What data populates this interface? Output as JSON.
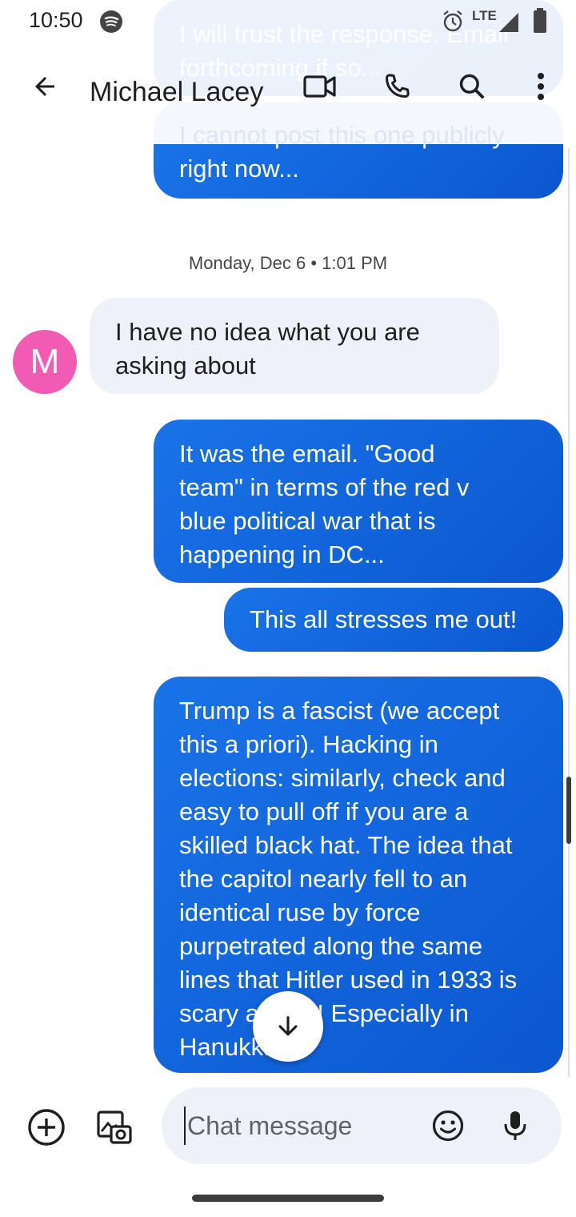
{
  "status": {
    "time": "10:50",
    "network": "LTE"
  },
  "header": {
    "contact_name": "Michael Lacey"
  },
  "conversation": {
    "top_messages": [
      {
        "text": "I will trust the response. Email forthcoming if so..."
      },
      {
        "text": "I cannot post this one publicly right now..."
      }
    ],
    "date_separator": "Monday, Dec 6 • 1:01 PM",
    "avatar_initial": "M",
    "incoming_1": "I have no idea what you are asking about",
    "outgoing_1": "It was the email. \"Good team\" in terms of the red v blue political war that is happening in DC...",
    "outgoing_2": "This all stresses me out!",
    "outgoing_3": "Trump is a fascist (we accept this a priori). Hacking in elections: similarly, check and easy to pull off if you are a skilled black hat. The idea that the capitol nearly fell to an identical ruse by force purpetrated along the same lines that Hitler used in 1933 is scary as hell! Especially in Hanukkah"
  },
  "composer": {
    "placeholder": "Chat message"
  },
  "colors": {
    "accent": "#1a73e8",
    "incoming_bubble": "#eef2f8",
    "avatar": "#f25bb4"
  },
  "icons": {
    "back": "arrow-back-icon",
    "video": "video-call-icon",
    "phone": "phone-icon",
    "search": "search-icon",
    "more": "more-vert-icon",
    "add": "add-circle-icon",
    "gallery": "gallery-camera-icon",
    "emoji": "emoji-icon",
    "mic": "mic-icon",
    "scroll_down": "arrow-down-icon"
  }
}
